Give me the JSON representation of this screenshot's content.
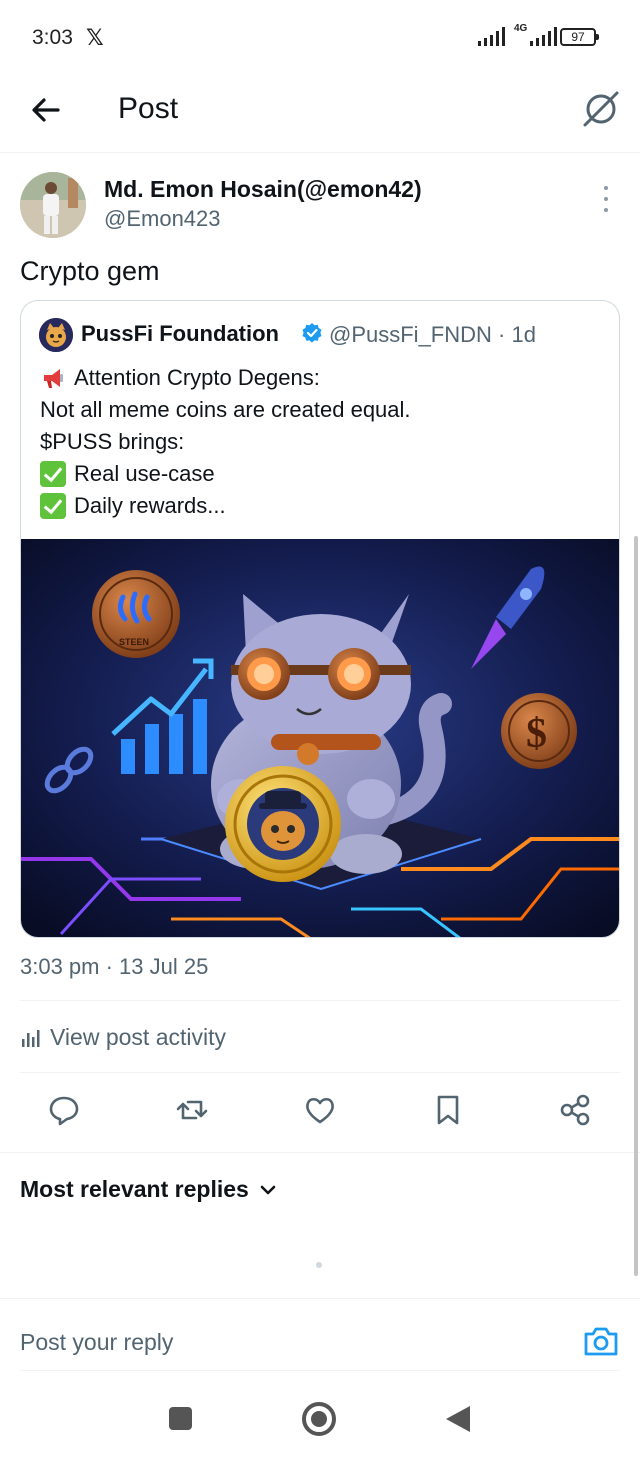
{
  "status_bar": {
    "time": "3:03",
    "app_icon": "x-logo-icon",
    "x_glyph": "𝕏",
    "network": "4G",
    "battery": "97"
  },
  "header": {
    "title": "Post",
    "back_icon": "arrow-left-icon",
    "grok_icon": "grok-icon"
  },
  "post": {
    "author_name": "Md. Emon Hosain(@emon42)",
    "author_handle": "@Emon423",
    "text": "Crypto gem",
    "timestamp": "3:03 pm · 13 Jul 25",
    "quote": {
      "name": "PussFi Foundation",
      "handle": "@PussFi_FNDN · 1d",
      "lines": [
        "Attention Crypto Degens:",
        "Not all meme coins are created equal.",
        "$PUSS brings:",
        "Real use-case",
        "Daily rewards..."
      ],
      "image_coin_label": "STEEN"
    }
  },
  "activity": {
    "label": "View post activity"
  },
  "actions": [
    "reply-icon",
    "repost-icon",
    "like-icon",
    "bookmark-icon",
    "share-icon"
  ],
  "replies": {
    "sort_label": "Most relevant replies"
  },
  "reply_box": {
    "placeholder": "Post your reply"
  },
  "colors": {
    "accent": "#1d9bf0",
    "text": "#0f1419",
    "secondary": "#536471",
    "border": "#cfd9de"
  }
}
